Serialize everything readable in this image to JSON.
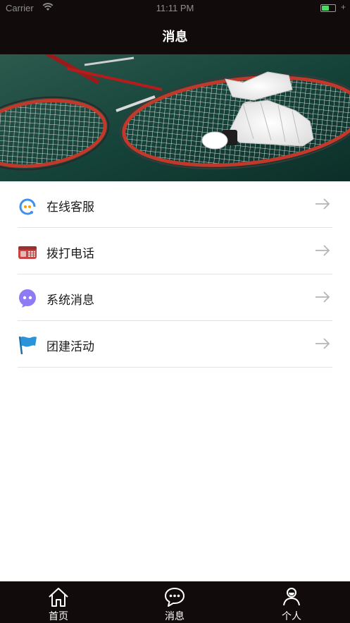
{
  "status_bar": {
    "carrier": "Carrier",
    "time": "11:11 PM",
    "battery_level": 0.55,
    "battery_color": "#4cd964"
  },
  "nav": {
    "title": "消息"
  },
  "banner": {
    "image": "badminton-rackets-and-shuttlecock-photo"
  },
  "menu": {
    "items": [
      {
        "label": "在线客服",
        "icon": "customer-service-headset-icon",
        "arrow": "arrow-right-icon"
      },
      {
        "label": "拨打电话",
        "icon": "telephone-icon",
        "arrow": "arrow-right-icon"
      },
      {
        "label": "系统消息",
        "icon": "system-message-bubble-icon",
        "arrow": "arrow-right-icon"
      },
      {
        "label": "团建活动",
        "icon": "flag-icon",
        "arrow": "arrow-right-icon"
      }
    ]
  },
  "tabbar": {
    "tabs": [
      {
        "label": "首页",
        "icon": "home-icon"
      },
      {
        "label": "消息",
        "icon": "chat-bubble-icon"
      },
      {
        "label": "个人",
        "icon": "person-icon"
      }
    ]
  },
  "colors": {
    "bar_background": "#120b0b",
    "divider": "#e3e3e3",
    "arrow": "#b5b5b5",
    "service_icon_blue": "#3d8ff0",
    "phone_icon_red": "#d9534f",
    "message_icon_purple": "#8f7af5",
    "flag_icon_blue": "#2b93d9"
  }
}
